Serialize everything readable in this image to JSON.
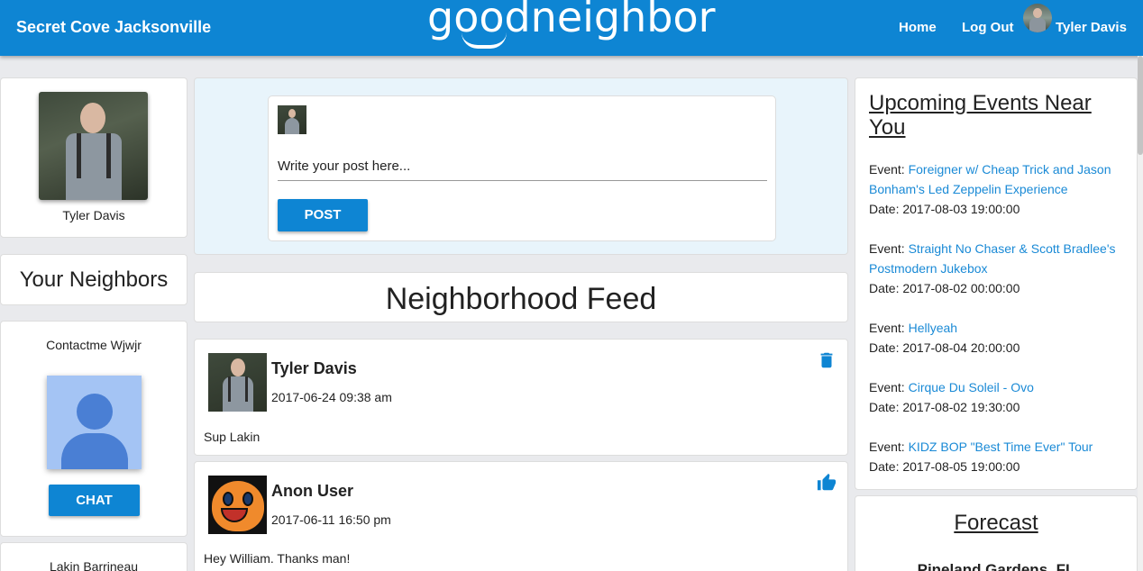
{
  "navbar": {
    "neighborhood": "Secret Cove Jacksonville",
    "logo": "goodneighbor",
    "home": "Home",
    "logout": "Log Out",
    "user_name": "Tyler Davis"
  },
  "profile": {
    "name": "Tyler Davis"
  },
  "neighbors": {
    "title": "Your Neighbors",
    "items": [
      {
        "name": "Contactme Wjwjr",
        "chat_label": "CHAT"
      },
      {
        "name": "Lakin Barrineau"
      }
    ]
  },
  "composer": {
    "placeholder": "Write your post here...",
    "post_label": "POST"
  },
  "feed": {
    "title": "Neighborhood Feed",
    "posts": [
      {
        "author": "Tyler Davis",
        "time": "2017-06-24 09:38 am",
        "text": "Sup Lakin",
        "icon": "trash-icon"
      },
      {
        "author": "Anon User",
        "time": "2017-06-11 16:50 pm",
        "text": "Hey William. Thanks man!",
        "icon": "thumbs-up-icon"
      }
    ]
  },
  "events": {
    "title": "Upcoming Events Near You",
    "event_prefix": "Event: ",
    "date_prefix": "Date: ",
    "items": [
      {
        "name": "Foreigner w/ Cheap Trick and Jason Bonham's Led Zeppelin Experience",
        "date": "2017-08-03 19:00:00"
      },
      {
        "name": "Straight No Chaser & Scott Bradlee's Postmodern Jukebox",
        "date": "2017-08-02 00:00:00"
      },
      {
        "name": "Hellyeah",
        "date": "2017-08-04 20:00:00"
      },
      {
        "name": "Cirque Du Soleil - Ovo",
        "date": "2017-08-02 19:30:00"
      },
      {
        "name": "KIDZ BOP \"Best Time Ever\" Tour",
        "date": "2017-08-05 19:00:00"
      }
    ]
  },
  "forecast": {
    "title": "Forecast",
    "location": "Pineland Gardens, FL"
  },
  "colors": {
    "brand": "#0e85d3",
    "link": "#1a8ad6",
    "page_bg": "#e9eaed",
    "composer_bg": "#e8f4fb"
  }
}
